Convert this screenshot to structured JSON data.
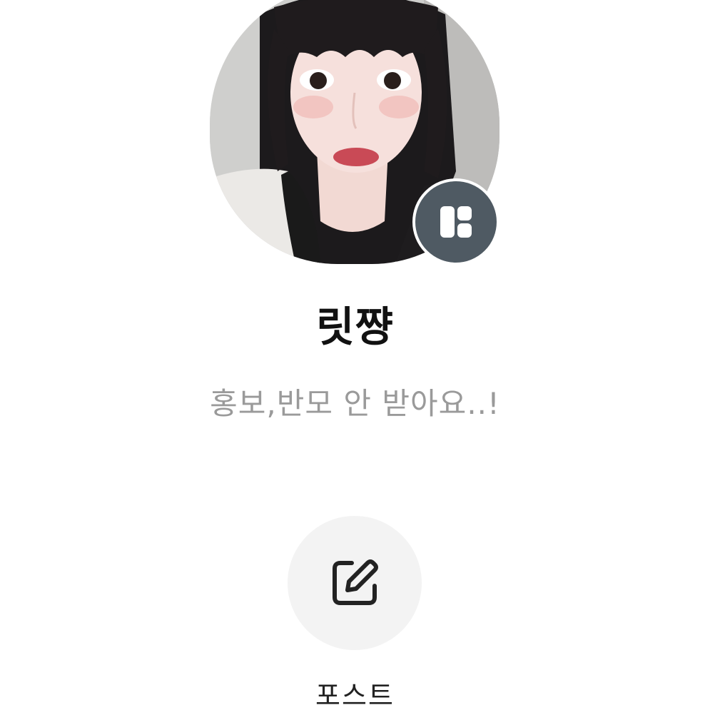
{
  "profile": {
    "nickname": "릿쨩",
    "status_message": "홍보,반모 안 받아요..!",
    "avatar_icon": "profile-photo",
    "badge_icon": "layout-grid-icon"
  },
  "actions": {
    "post_label": "포스트",
    "post_icon": "edit-pencil-icon"
  },
  "colors": {
    "badge_bg": "#4f5a63",
    "status_text": "#9a9a9a",
    "nickname_text": "#111111",
    "action_circle_bg": "#f3f3f3"
  }
}
